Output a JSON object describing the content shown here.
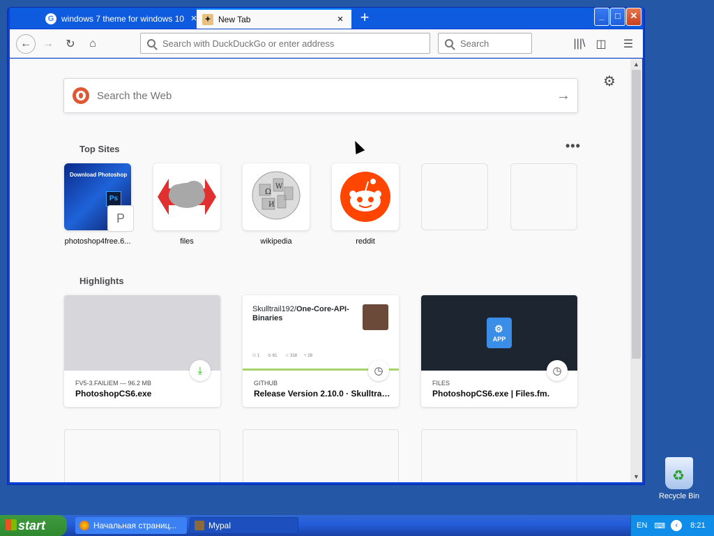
{
  "browser": {
    "tabs": [
      {
        "label": "windows 7 theme for windows 10",
        "icon": "google-icon",
        "active": false
      },
      {
        "label": "New Tab",
        "icon": "firefox-newtab-icon",
        "active": true
      }
    ],
    "new_tab_symbol": "+",
    "close_symbol": "×",
    "url_placeholder": "Search with DuckDuckGo or enter address",
    "search_placeholder": "Search"
  },
  "newtab": {
    "web_search_placeholder": "Search the Web",
    "top_sites_heading": "Top Sites",
    "highlights_heading": "Highlights",
    "top_sites": [
      {
        "label": "photoshop4free.6...",
        "badge": "P"
      },
      {
        "label": "files"
      },
      {
        "label": "wikipedia"
      },
      {
        "label": "reddit"
      }
    ],
    "photoshop_tile_text": "Download Photoshop",
    "ps_logo": "Ps",
    "highlights": [
      {
        "source": "FV5-3.FAILIEM — 96.2 MB",
        "title": "PhotoshopCS6.exe",
        "badge_icon": "download-icon"
      },
      {
        "source": "GITHUB",
        "title": "Release Version 2.10.0 · Skulltrai...",
        "badge_icon": "clock-icon",
        "card_repo_owner": "Skulltrail192/",
        "card_repo_name": "One-Core-API-Binaries"
      },
      {
        "source": "FILES",
        "title": "PhotoshopCS6.exe | Files.fm.",
        "badge_icon": "clock-icon",
        "app_label": "APP"
      }
    ]
  },
  "taskbar": {
    "start_label": "start",
    "items": [
      {
        "label": "Начальная страниц...",
        "icon": "firefox-icon"
      },
      {
        "label": "Mypal",
        "icon": "mypal-icon"
      }
    ],
    "language": "EN",
    "clock": "8:21"
  },
  "desktop": {
    "recycle_bin_label": "Recycle Bin"
  },
  "colors": {
    "accent": "#0a84ff",
    "reddit": "#ff4500",
    "xp_blue": "#245edb"
  }
}
